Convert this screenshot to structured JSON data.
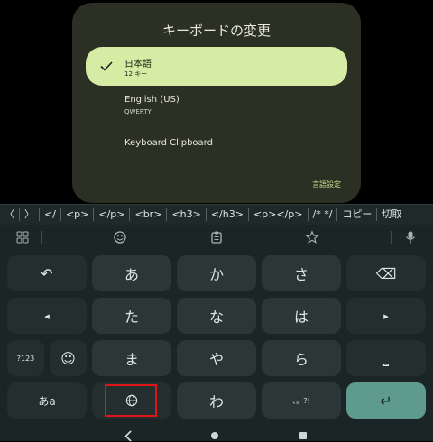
{
  "dialog": {
    "title": "キーボードの変更",
    "options": [
      {
        "name": "日本語",
        "sub": "12 キー",
        "selected": true
      },
      {
        "name": "English (US)",
        "sub": "QWERTY"
      },
      {
        "name": "Keyboard Clipboard"
      }
    ],
    "settings_link": "言語設定"
  },
  "suggestions": [
    "〈",
    "〉",
    "</",
    "<p>",
    "</p>",
    "<br>",
    "<h3>",
    "</h3>",
    "<p></p>",
    "/* */",
    "コピー",
    "切取"
  ],
  "keyboard": {
    "toolbar_icons": [
      "grid-icon",
      "emoji-icon",
      "clipboard-icon",
      "star-icon",
      "mic-icon"
    ],
    "keys": {
      "undo": "↶",
      "a": "あ",
      "ka": "か",
      "sa": "さ",
      "backspace": "⌫",
      "left": "◂",
      "ta": "た",
      "na": "な",
      "ha": "は",
      "right": "▸",
      "num": "?123",
      "emoji": "☺",
      "ma": "ま",
      "ya": "や",
      "ra": "ら",
      "space": "⎵",
      "kana": "あa",
      "globe": "🌐",
      "wa": "わ",
      "punct": "、。?!",
      "enter": "↵"
    },
    "colors": {
      "accent": "#5e9a8d",
      "highlight": "#e01414",
      "selected_option": "#d6eba4"
    }
  }
}
